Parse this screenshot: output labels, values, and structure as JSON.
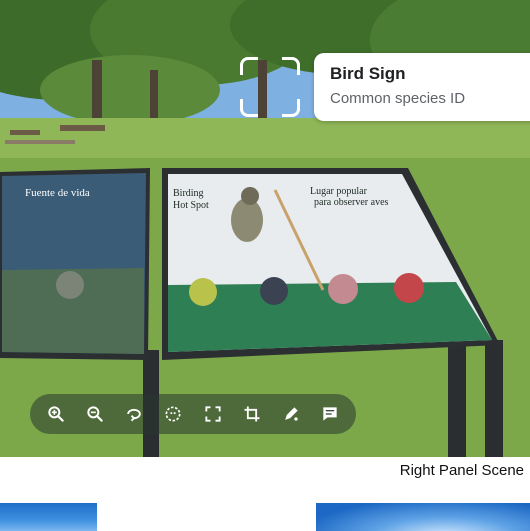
{
  "result": {
    "title": "Bird Sign",
    "subtitle": "Common species ID"
  },
  "sign": {
    "left_panel_title": "Fuente de vida",
    "left_panel_title_alt": "Birding",
    "left_panel_title_alt2": "Hot Spot",
    "right_panel_title_line1": "Lugar popular",
    "right_panel_title_line2": "para observer aves"
  },
  "toolbar": {
    "tools": [
      {
        "name": "zoom-in-icon"
      },
      {
        "name": "zoom-out-icon"
      },
      {
        "name": "rotate-icon"
      },
      {
        "name": "select-subject-icon"
      },
      {
        "name": "fit-screen-icon"
      },
      {
        "name": "crop-icon"
      },
      {
        "name": "markup-icon"
      },
      {
        "name": "caption-icon"
      }
    ]
  },
  "caption": "Right Panel Scene",
  "colors": {
    "toolbar_bg": "#28372d",
    "sign_panel": "#2f7f55",
    "accent_white": "#ffffff"
  }
}
